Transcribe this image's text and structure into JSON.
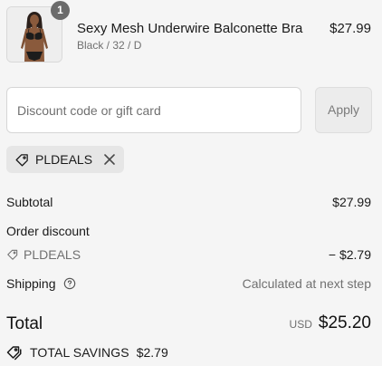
{
  "product": {
    "quantity": "1",
    "name": "Sexy Mesh Underwire Balconette Bra",
    "variant": "Black / 32 / D",
    "price": "$27.99"
  },
  "discount": {
    "placeholder": "Discount code or gift card",
    "value": "",
    "apply_label": "Apply",
    "applied_code": "PLDEALS"
  },
  "summary": {
    "subtotal_label": "Subtotal",
    "subtotal_value": "$27.99",
    "order_discount_label": "Order discount",
    "order_discount_code": "PLDEALS",
    "order_discount_value": "− $2.79",
    "shipping_label": "Shipping",
    "shipping_value": "Calculated at next step",
    "total_label": "Total",
    "total_currency": "USD",
    "total_value": "$25.20",
    "savings_label": "TOTAL SAVINGS",
    "savings_value": "$2.79"
  },
  "icons": {
    "tag": "tag-icon",
    "close": "close-icon",
    "help": "help-circle-icon",
    "savings_tag": "double-tag-icon"
  },
  "colors": {
    "background": "#f5f5f5",
    "chip_background": "#e6e6e6",
    "apply_background": "#ececec",
    "badge": "#6b6b6b"
  }
}
